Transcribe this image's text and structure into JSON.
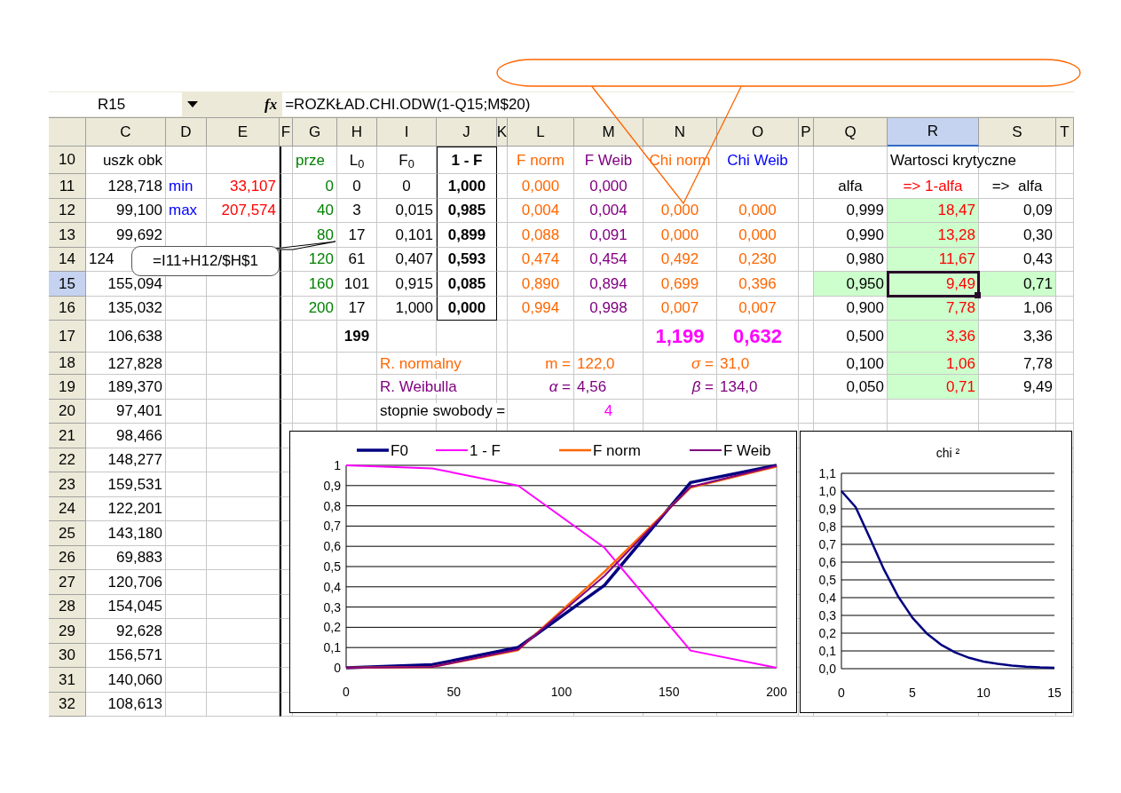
{
  "formula_bar": {
    "name_box": "R15",
    "function_label": "fx",
    "formula": "=ROZKŁAD.CHI.ODW(1-Q15;M$20)"
  },
  "comment": {
    "text": "=I11+H12/$H$1"
  },
  "sheet": {
    "columns": [
      {
        "label": "C",
        "selected": false
      },
      {
        "label": "D",
        "selected": false
      },
      {
        "label": "E",
        "selected": false
      },
      {
        "label": "F",
        "selected": false
      },
      {
        "label": "G",
        "selected": false
      },
      {
        "label": "H",
        "selected": false
      },
      {
        "label": "I",
        "selected": false
      },
      {
        "label": "J",
        "selected": false
      },
      {
        "label": "K",
        "selected": false
      },
      {
        "label": "L",
        "selected": false
      },
      {
        "label": "M",
        "selected": false
      },
      {
        "label": "N",
        "selected": false
      },
      {
        "label": "O",
        "selected": false
      },
      {
        "label": "P",
        "selected": false
      },
      {
        "label": "Q",
        "selected": false
      },
      {
        "label": "R",
        "selected": true
      },
      {
        "label": "S",
        "selected": false
      },
      {
        "label": "T",
        "selected": false
      }
    ],
    "rows": [
      {
        "number": "10",
        "selected": false,
        "cells": [
          {
            "kind": "plain",
            "text": "uszk obk"
          },
          {
            "kind": "blank"
          },
          {
            "kind": "blank"
          },
          {
            "kind": "blank"
          },
          {
            "kind": "bin_label",
            "text": "prze"
          },
          {
            "kind": "plain",
            "text": "L$_{0}$"
          },
          {
            "kind": "heading",
            "text": "F$_{0}$"
          },
          {
            "kind": "strong",
            "text": "1 - F"
          },
          {
            "kind": "blank"
          },
          {
            "kind": "normal",
            "text": "F norm"
          },
          {
            "kind": "weibull",
            "text": "F Weib"
          },
          {
            "kind": "normal",
            "text": "Chi norm"
          },
          {
            "kind": "caption",
            "text": "Chi Weib"
          },
          {
            "kind": "blank"
          },
          {
            "kind": "blank"
          },
          {
            "kind": "label",
            "text": "Wartosci krytyczne"
          }
        ]
      },
      {
        "number": "11",
        "selected": false,
        "cells": [
          {
            "kind": "plain",
            "text": "128,718"
          },
          {
            "kind": "caption",
            "text": "min"
          },
          {
            "kind": "extreme",
            "text": "33,107"
          },
          {
            "kind": "blank"
          },
          {
            "kind": "bin",
            "text": "0"
          },
          {
            "kind": "plain",
            "text": "0"
          },
          {
            "kind": "heading",
            "text": "0"
          },
          {
            "kind": "strong",
            "text": "1,000"
          },
          {
            "kind": "blank"
          },
          {
            "kind": "normal",
            "text": "0,000"
          },
          {
            "kind": "weibull",
            "text": "0,000"
          },
          {
            "kind": "blank"
          },
          {
            "kind": "blank"
          },
          {
            "kind": "blank"
          },
          {
            "kind": "heading",
            "text": "alfa"
          },
          {
            "kind": "critical_heading",
            "text": "=> 1-alfa"
          },
          {
            "kind": "heading",
            "text": "=>  alfa"
          }
        ]
      },
      {
        "number": "12",
        "selected": false,
        "cells": [
          {
            "kind": "plain",
            "text": "99,100"
          },
          {
            "kind": "caption",
            "text": "max"
          },
          {
            "kind": "extreme",
            "text": "207,574"
          },
          {
            "kind": "blank"
          },
          {
            "kind": "bin",
            "text": "40"
          },
          {
            "kind": "plain",
            "text": "3"
          },
          {
            "kind": "plain",
            "text": "0,015"
          },
          {
            "kind": "strong",
            "text": "0,985"
          },
          {
            "kind": "blank"
          },
          {
            "kind": "normal",
            "text": "0,004"
          },
          {
            "kind": "weibull",
            "text": "0,004"
          },
          {
            "kind": "normal",
            "text": "0,000"
          },
          {
            "kind": "normal",
            "text": "0,000"
          },
          {
            "kind": "blank"
          },
          {
            "kind": "plain",
            "text": "0,999"
          },
          {
            "kind": "critical",
            "text": "18,47"
          },
          {
            "kind": "plain",
            "text": "0,09"
          }
        ]
      },
      {
        "number": "13",
        "selected": false,
        "cells": [
          {
            "kind": "plain",
            "text": "99,692"
          },
          {
            "kind": "blank"
          },
          {
            "kind": "blank"
          },
          {
            "kind": "blank"
          },
          {
            "kind": "bin",
            "text": "80"
          },
          {
            "kind": "plain",
            "text": "17"
          },
          {
            "kind": "plain",
            "text": "0,101"
          },
          {
            "kind": "strong",
            "text": "0,899"
          },
          {
            "kind": "blank"
          },
          {
            "kind": "normal",
            "text": "0,088"
          },
          {
            "kind": "weibull",
            "text": "0,091"
          },
          {
            "kind": "normal",
            "text": "0,000"
          },
          {
            "kind": "normal",
            "text": "0,000"
          },
          {
            "kind": "blank"
          },
          {
            "kind": "plain",
            "text": "0,990"
          },
          {
            "kind": "critical",
            "text": "13,28"
          },
          {
            "kind": "plain",
            "text": "0,30"
          }
        ]
      },
      {
        "number": "14",
        "selected": false,
        "cells": [
          {
            "kind": "label",
            "text": "124"
          },
          {
            "kind": "blank"
          },
          {
            "kind": "blank"
          },
          {
            "kind": "blank"
          },
          {
            "kind": "bin",
            "text": "120"
          },
          {
            "kind": "plain",
            "text": "61"
          },
          {
            "kind": "plain",
            "text": "0,407"
          },
          {
            "kind": "strong",
            "text": "0,593"
          },
          {
            "kind": "blank"
          },
          {
            "kind": "normal",
            "text": "0,474"
          },
          {
            "kind": "weibull",
            "text": "0,454"
          },
          {
            "kind": "normal",
            "text": "0,492"
          },
          {
            "kind": "normal",
            "text": "0,230"
          },
          {
            "kind": "blank"
          },
          {
            "kind": "plain",
            "text": "0,980"
          },
          {
            "kind": "critical",
            "text": "11,67"
          },
          {
            "kind": "plain",
            "text": "0,43"
          }
        ]
      },
      {
        "number": "15",
        "selected": true,
        "cells": [
          {
            "kind": "plain",
            "text": "155,094"
          },
          {
            "kind": "blank"
          },
          {
            "kind": "blank"
          },
          {
            "kind": "blank"
          },
          {
            "kind": "bin",
            "text": "160"
          },
          {
            "kind": "plain",
            "text": "101"
          },
          {
            "kind": "plain",
            "text": "0,915"
          },
          {
            "kind": "strong",
            "text": "0,085"
          },
          {
            "kind": "blank"
          },
          {
            "kind": "normal",
            "text": "0,890"
          },
          {
            "kind": "weibull",
            "text": "0,894"
          },
          {
            "kind": "normal",
            "text": "0,699"
          },
          {
            "kind": "normal",
            "text": "0,396"
          },
          {
            "kind": "blank"
          },
          {
            "kind": "plain_shaded",
            "text": "0,950"
          },
          {
            "kind": "critical",
            "text": "9,49"
          },
          {
            "kind": "plain_shaded",
            "text": "0,71"
          }
        ]
      },
      {
        "number": "16",
        "selected": false,
        "cells": [
          {
            "kind": "plain",
            "text": "135,032"
          },
          {
            "kind": "blank"
          },
          {
            "kind": "blank"
          },
          {
            "kind": "blank"
          },
          {
            "kind": "bin",
            "text": "200"
          },
          {
            "kind": "plain",
            "text": "17"
          },
          {
            "kind": "plain",
            "text": "1,000"
          },
          {
            "kind": "strong",
            "text": "0,000"
          },
          {
            "kind": "blank"
          },
          {
            "kind": "normal",
            "text": "0,994"
          },
          {
            "kind": "weibull",
            "text": "0,998"
          },
          {
            "kind": "normal",
            "text": "0,007"
          },
          {
            "kind": "normal",
            "text": "0,007"
          },
          {
            "kind": "blank"
          },
          {
            "kind": "plain",
            "text": "0,900"
          },
          {
            "kind": "critical",
            "text": "7,78"
          },
          {
            "kind": "plain",
            "text": "1,06"
          }
        ]
      },
      {
        "number": "17",
        "selected": false,
        "cells": [
          {
            "kind": "plain",
            "text": "106,638"
          },
          {
            "kind": "blank"
          },
          {
            "kind": "blank"
          },
          {
            "kind": "blank"
          },
          {
            "kind": "blank"
          },
          {
            "kind": "strong",
            "text": "199"
          },
          {
            "kind": "blank"
          },
          {
            "kind": "blank"
          },
          {
            "kind": "blank"
          },
          {
            "kind": "blank"
          },
          {
            "kind": "blank"
          },
          {
            "kind": "sum",
            "text": "1,199"
          },
          {
            "kind": "sum",
            "text": "0,632"
          },
          {
            "kind": "blank"
          },
          {
            "kind": "plain",
            "text": "0,500"
          },
          {
            "kind": "critical",
            "text": "3,36"
          },
          {
            "kind": "plain",
            "text": "3,36"
          }
        ]
      },
      {
        "number": "18",
        "selected": false,
        "cells": [
          {
            "kind": "plain",
            "text": "127,828"
          },
          {
            "kind": "blank"
          },
          {
            "kind": "blank"
          },
          {
            "kind": "blank"
          },
          {
            "kind": "blank"
          },
          {
            "kind": "blank"
          },
          {
            "kind": "normal_label",
            "text": "R. normalny"
          },
          {
            "kind": "blank"
          },
          {
            "kind": "blank"
          },
          {
            "kind": "normal_symbol",
            "text": "m ="
          },
          {
            "kind": "normal_label",
            "text": "122,0"
          },
          {
            "kind": "normal_symbol",
            "text": "*σ* ="
          },
          {
            "kind": "normal_label",
            "text": "31,0"
          },
          {
            "kind": "blank"
          },
          {
            "kind": "plain",
            "text": "0,100"
          },
          {
            "kind": "critical",
            "text": "1,06"
          },
          {
            "kind": "plain",
            "text": "7,78"
          }
        ]
      },
      {
        "number": "19",
        "selected": false,
        "cells": [
          {
            "kind": "plain",
            "text": "189,370"
          },
          {
            "kind": "blank"
          },
          {
            "kind": "blank"
          },
          {
            "kind": "blank"
          },
          {
            "kind": "blank"
          },
          {
            "kind": "blank"
          },
          {
            "kind": "weibull_label",
            "text": "R. Weibulla"
          },
          {
            "kind": "blank"
          },
          {
            "kind": "blank"
          },
          {
            "kind": "weibull_symbol",
            "text": "*α* ="
          },
          {
            "kind": "weibull_label",
            "text": "4,56"
          },
          {
            "kind": "weibull_symbol",
            "text": "*β* ="
          },
          {
            "kind": "weibull_label",
            "text": "134,0"
          },
          {
            "kind": "blank"
          },
          {
            "kind": "plain",
            "text": "0,050"
          },
          {
            "kind": "critical",
            "text": "0,71"
          },
          {
            "kind": "plain",
            "text": "9,49"
          }
        ]
      },
      {
        "number": "20",
        "selected": false,
        "cells": [
          {
            "kind": "plain",
            "text": "97,401"
          },
          {
            "kind": "blank"
          },
          {
            "kind": "blank"
          },
          {
            "kind": "blank"
          },
          {
            "kind": "blank"
          },
          {
            "kind": "blank"
          },
          {
            "kind": "label",
            "text": "stopnie swobody ="
          },
          {
            "kind": "blank"
          },
          {
            "kind": "blank"
          },
          {
            "kind": "blank"
          },
          {
            "kind": "df",
            "text": "4"
          }
        ]
      },
      {
        "number": "21",
        "selected": false,
        "cells": [
          {
            "kind": "plain",
            "text": "98,466"
          }
        ]
      },
      {
        "number": "22",
        "selected": false,
        "cells": [
          {
            "kind": "plain",
            "text": "148,277"
          }
        ]
      },
      {
        "number": "23",
        "selected": false,
        "cells": [
          {
            "kind": "plain",
            "text": "159,531"
          }
        ]
      },
      {
        "number": "24",
        "selected": false,
        "cells": [
          {
            "kind": "plain",
            "text": "122,201"
          }
        ]
      },
      {
        "number": "25",
        "selected": false,
        "cells": [
          {
            "kind": "plain",
            "text": "143,180"
          }
        ]
      },
      {
        "number": "26",
        "selected": false,
        "cells": [
          {
            "kind": "plain",
            "text": "69,883"
          }
        ]
      },
      {
        "number": "27",
        "selected": false,
        "cells": [
          {
            "kind": "plain",
            "text": "120,706"
          }
        ]
      },
      {
        "number": "28",
        "selected": false,
        "cells": [
          {
            "kind": "plain",
            "text": "154,045"
          }
        ]
      },
      {
        "number": "29",
        "selected": false,
        "cells": [
          {
            "kind": "plain",
            "text": "92,628"
          }
        ]
      },
      {
        "number": "30",
        "selected": false,
        "cells": [
          {
            "kind": "plain",
            "text": "156,571"
          }
        ]
      },
      {
        "number": "31",
        "selected": false,
        "cells": [
          {
            "kind": "plain",
            "text": "140,060"
          }
        ]
      },
      {
        "number": "32",
        "selected": false,
        "cells": [
          {
            "kind": "plain",
            "text": "108,613"
          }
        ]
      }
    ]
  },
  "charts": [
    {
      "chart_data": {
        "type": "line",
        "x": [
          0,
          40,
          80,
          120,
          160,
          200
        ],
        "series": [
          {
            "name": "F0",
            "color": "#000080",
            "values": [
              0,
              0.015,
              0.101,
              0.407,
              0.915,
              1
            ]
          },
          {
            "name": "1 - F",
            "color": "#ff00ff",
            "values": [
              1,
              0.985,
              0.899,
              0.593,
              0.085,
              0
            ]
          },
          {
            "name": "F norm",
            "color": "#ff6600",
            "values": [
              0,
              0.004,
              0.088,
              0.474,
              0.89,
              0.994
            ]
          },
          {
            "name": "F Weib",
            "color": "#800080",
            "values": [
              0,
              0.004,
              0.091,
              0.454,
              0.894,
              0.998
            ]
          }
        ],
        "grid": true,
        "legend": true,
        "xlim": [
          0,
          200
        ],
        "ylim": [
          0,
          1
        ],
        "xticks": [
          {
            "value": 0,
            "label": "0"
          },
          {
            "value": 50,
            "label": "50"
          },
          {
            "value": 100,
            "label": "100"
          },
          {
            "value": 150,
            "label": "150"
          },
          {
            "value": 200,
            "label": "200"
          }
        ],
        "yticks": [
          {
            "value": 0,
            "label": "0"
          },
          {
            "value": 0.1,
            "label": "0,1"
          },
          {
            "value": 0.2,
            "label": "0,2"
          },
          {
            "value": 0.3,
            "label": "0,3"
          },
          {
            "value": 0.4,
            "label": "0,4"
          },
          {
            "value": 0.5,
            "label": "0,5"
          },
          {
            "value": 0.6,
            "label": "0,6"
          },
          {
            "value": 0.7,
            "label": "0,7"
          },
          {
            "value": 0.8,
            "label": "0,8"
          },
          {
            "value": 0.9,
            "label": "0,9"
          },
          {
            "value": 1,
            "label": "1"
          }
        ]
      }
    },
    {
      "chart_data": {
        "type": "line",
        "title": "chi ²",
        "x": [
          0,
          1,
          2,
          3,
          4,
          5,
          6,
          7,
          8,
          9,
          10,
          11,
          12,
          13,
          14,
          15
        ],
        "values": [
          1,
          0.91,
          0.736,
          0.558,
          0.406,
          0.287,
          0.199,
          0.136,
          0.092,
          0.061,
          0.04,
          0.027,
          0.017,
          0.011,
          0.007,
          0.005
        ],
        "grid": true,
        "xlim": [
          0,
          15
        ],
        "ylim": [
          0,
          1.1
        ],
        "xticks": [
          {
            "value": 0,
            "label": "0"
          },
          {
            "value": 5,
            "label": "5"
          },
          {
            "value": 10,
            "label": "10"
          },
          {
            "value": 15,
            "label": "15"
          }
        ],
        "yticks": [
          {
            "value": 0,
            "label": "0,0"
          },
          {
            "value": 0.1,
            "label": "0,1"
          },
          {
            "value": 0.2,
            "label": "0,2"
          },
          {
            "value": 0.3,
            "label": "0,3"
          },
          {
            "value": 0.4,
            "label": "0,4"
          },
          {
            "value": 0.5,
            "label": "0,5"
          },
          {
            "value": 0.6,
            "label": "0,6"
          },
          {
            "value": 0.7,
            "label": "0,7"
          },
          {
            "value": 0.8,
            "label": "0,8"
          },
          {
            "value": 0.9,
            "label": "0,9"
          },
          {
            "value": 1,
            "label": "1,0"
          },
          {
            "value": 1.1,
            "label": "1,1"
          }
        ]
      }
    }
  ]
}
